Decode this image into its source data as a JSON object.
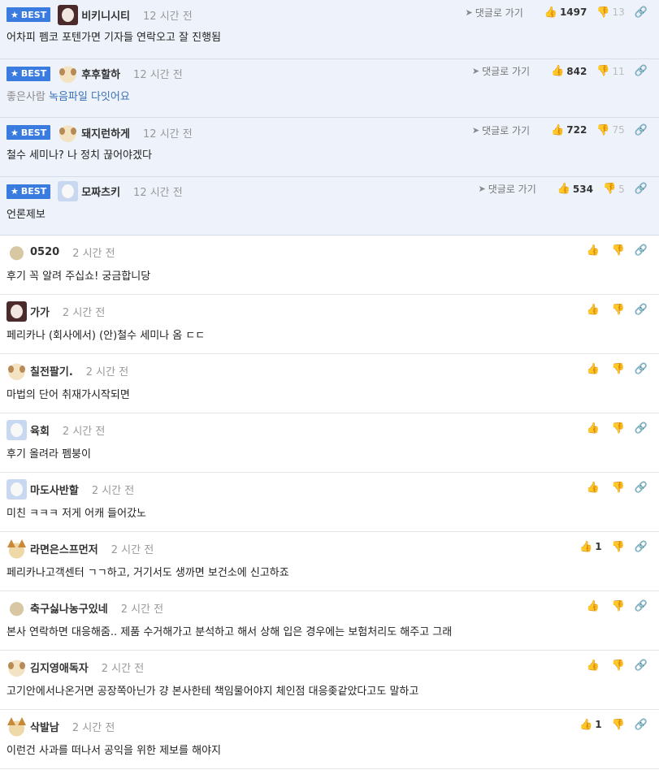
{
  "best_label": "BEST",
  "reply_label": "댓글로 가기",
  "best_comments": [
    {
      "avatar": "dog-icon",
      "nick": "비키니시티",
      "time": "12 시간 전",
      "likes": "1497",
      "dislikes": "13",
      "text": "어차피 펨코 포텐가면 기자들 연락오고 잘 진행됨"
    },
    {
      "avatar": "puppy-icon",
      "nick": "후후할하",
      "time": "12 시간 전",
      "likes": "842",
      "dislikes": "11",
      "text_sub": "좋은사람",
      "text_main": "녹음파일 다잇어요"
    },
    {
      "avatar": "puppy-icon",
      "nick": "돼지런하게",
      "time": "12 시간 전",
      "likes": "722",
      "dislikes": "75",
      "text": "철수 세미나? 나 정치 끊어야겠다"
    },
    {
      "avatar": "face-icon",
      "nick": "모짜츠키",
      "time": "12 시간 전",
      "likes": "534",
      "dislikes": "5",
      "text": "언론제보"
    }
  ],
  "comments": [
    {
      "avatar": "blob-icon",
      "nick": "0520",
      "time": "2 시간 전",
      "likes": "",
      "text": "후기 꼭 알려 주십쇼! 궁금합니당"
    },
    {
      "avatar": "red-face-icon",
      "nick": "가가",
      "time": "2 시간 전",
      "likes": "",
      "text": "페리카나 (회사에서) (안)철수 세미나 옴 ㄷㄷ"
    },
    {
      "avatar": "puppy-icon",
      "nick": "칠전팔기.",
      "time": "2 시간 전",
      "likes": "",
      "text": "마법의 단어 취재가시작되면"
    },
    {
      "avatar": "face-icon",
      "nick": "육회",
      "time": "2 시간 전",
      "likes": "",
      "text": "후기 올려라 펨붕이"
    },
    {
      "avatar": "face-icon",
      "nick": "마도사반할",
      "time": "2 시간 전",
      "likes": "",
      "text": "미친 ㅋㅋㅋ 저게 어캐 들어갔노"
    },
    {
      "avatar": "fox-icon",
      "nick": "라면은스프먼저",
      "time": "2 시간 전",
      "likes": "1",
      "text": "페리카나고객센터 ㄱㄱ하고, 거기서도 생까면 보건소에 신고하죠"
    },
    {
      "avatar": "blob-icon",
      "nick": "축구싫나농구있네",
      "time": "2 시간 전",
      "likes": "",
      "text": "본사 연락하면 대응해줌.. 제품 수거해가고 분석하고 해서 상해 입은 경우에는 보험처리도 해주고 그래"
    },
    {
      "avatar": "puppy-icon",
      "nick": "김지영애독자",
      "time": "2 시간 전",
      "likes": "",
      "text": "고기안에서나온거면 공장쪽아닌가 걍 본사한테 책임물어야지 체인점 대응좆같았다고도 말하고"
    },
    {
      "avatar": "fox-icon",
      "nick": "삭발남",
      "time": "2 시간 전",
      "likes": "1",
      "text": "이런건 사과를 떠나서 공익을 위한 제보를 해야지"
    }
  ]
}
